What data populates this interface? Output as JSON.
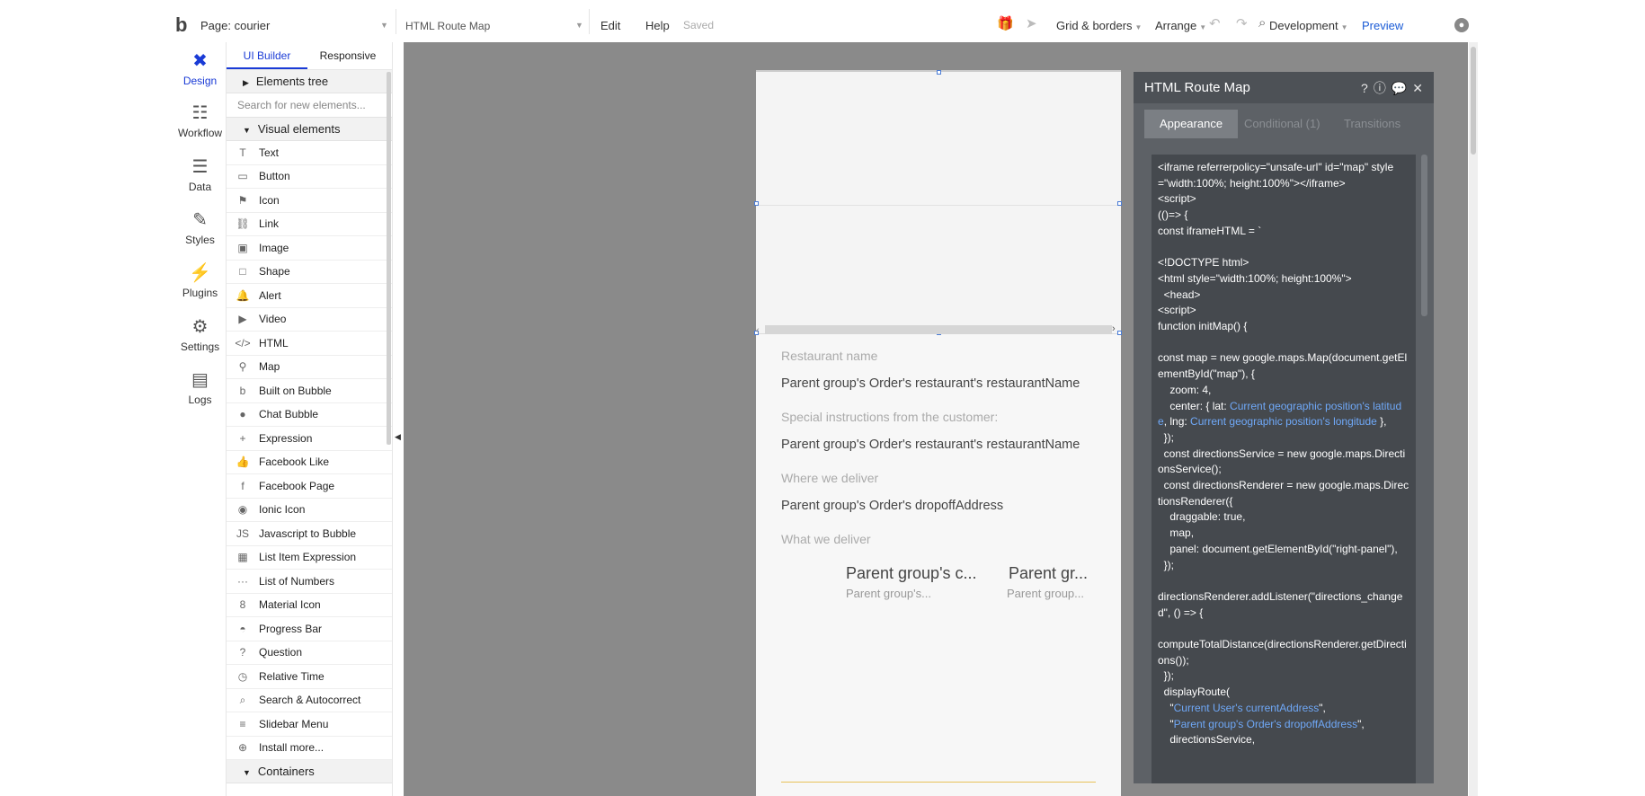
{
  "topbar": {
    "logo": "b",
    "page_label": "Page: courier",
    "element_label": "HTML Route Map",
    "edit": "Edit",
    "help": "Help",
    "saved": "Saved",
    "grid_borders": "Grid & borders",
    "arrange": "Arrange",
    "development": "Development",
    "preview": "Preview"
  },
  "rail": {
    "items": [
      {
        "label": "Design",
        "icon": "design-icon"
      },
      {
        "label": "Workflow",
        "icon": "workflow-icon"
      },
      {
        "label": "Data",
        "icon": "data-icon"
      },
      {
        "label": "Styles",
        "icon": "styles-icon"
      },
      {
        "label": "Plugins",
        "icon": "plugins-icon"
      },
      {
        "label": "Settings",
        "icon": "settings-icon"
      },
      {
        "label": "Logs",
        "icon": "logs-icon"
      }
    ]
  },
  "palette": {
    "tabs": [
      "UI Builder",
      "Responsive"
    ],
    "elements_tree": "Elements tree",
    "search_placeholder": "Search for new elements...",
    "visual_elements": "Visual elements",
    "items": [
      "Text",
      "Button",
      "Icon",
      "Link",
      "Image",
      "Shape",
      "Alert",
      "Video",
      "HTML",
      "Map",
      "Built on Bubble",
      "Chat Bubble",
      "Expression",
      "Facebook Like",
      "Facebook Page",
      "Ionic Icon",
      "Javascript to Bubble",
      "List Item Expression",
      "List of Numbers",
      "Material Icon",
      "Progress Bar",
      "Question",
      "Relative Time",
      "Search & Autocorrect",
      "Slidebar Menu",
      "Install more..."
    ],
    "containers": "Containers"
  },
  "phone": {
    "restaurant_label": "Restaurant name",
    "restaurant_value": "Parent group's Order's restaurant's restaurantName",
    "instructions_label": "Special instructions from the customer:",
    "instructions_value": "Parent group's Order's restaurant's restaurantName",
    "where_label": "Where we deliver",
    "where_value": "Parent group's Order's dropoffAddress",
    "what_label": "What we deliver",
    "rg1_title": "Parent group's c...",
    "rg1_sub": "Parent group's...",
    "rg2_title": "Parent gr...",
    "rg2_sub": "Parent group..."
  },
  "property_editor": {
    "title": "HTML Route Map",
    "tabs": [
      "Appearance",
      "Conditional (1)",
      "Transitions"
    ]
  }
}
